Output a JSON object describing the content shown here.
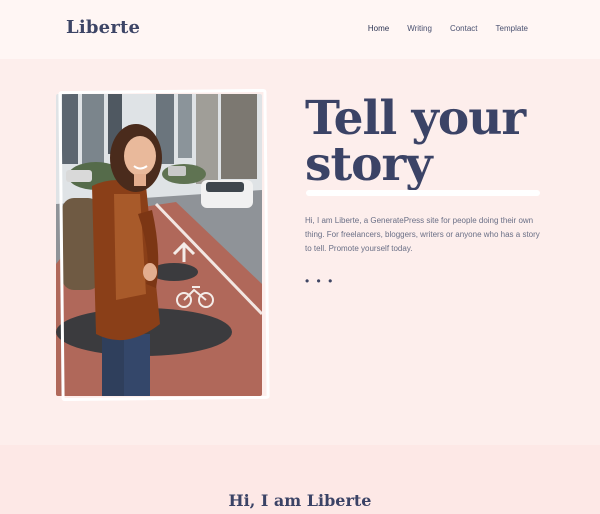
{
  "site": {
    "logo": "Liberte"
  },
  "nav": {
    "items": [
      {
        "label": "Home",
        "active": true
      },
      {
        "label": "Writing",
        "active": false
      },
      {
        "label": "Contact",
        "active": false
      },
      {
        "label": "Template",
        "active": false
      }
    ]
  },
  "hero": {
    "headline": "Tell your story",
    "intro": "Hi, I am Liberte, a GeneratePress site for people doing their own thing. For freelancers, bloggers, writers or anyone who has a story to tell. Promote yourself today.",
    "dots": "• • •"
  },
  "section2": {
    "title": "Hi, I am Liberte"
  },
  "colors": {
    "background": "#fdeeec",
    "header": "#fff6f4",
    "text": "#3b4366"
  }
}
